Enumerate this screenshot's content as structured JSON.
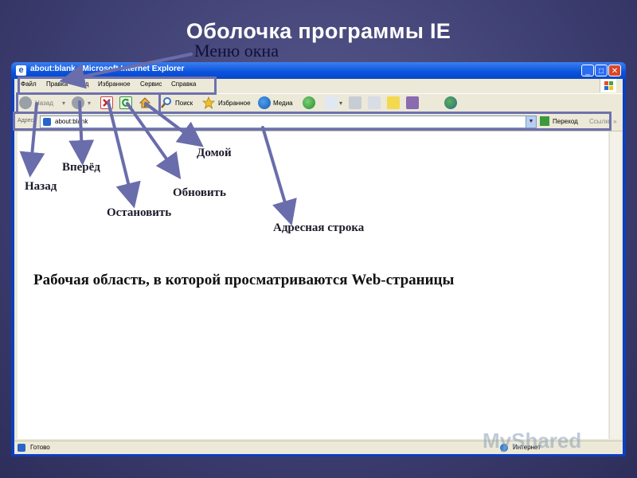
{
  "slide": {
    "title": "Оболочка программы IE",
    "menu_caption": "Меню окна"
  },
  "window": {
    "title": "about:blank - Microsoft Internet Explorer",
    "menu": [
      "Файл",
      "Правка",
      "Вид",
      "Избранное",
      "Сервис",
      "Справка"
    ],
    "toolbar": {
      "back": "Назад",
      "search": "Поиск",
      "favorites": "Избранное",
      "media": "Медиа"
    },
    "address": {
      "label": "Адрес",
      "value": "about:blank",
      "go": "Переход",
      "links": "Ссылки"
    },
    "status": {
      "text": "Готово",
      "zone": "Интернет"
    }
  },
  "annotations": {
    "back": "Назад",
    "forward": "Вперёд",
    "stop": "Остановить",
    "refresh": "Обновить",
    "home": "Домой",
    "address_bar": "Адресная строка",
    "work_area": "Рабочая область, в которой просматриваются Web-страницы"
  },
  "watermark": "MyShared",
  "colors": {
    "slide_background": "#3f4074",
    "title_bar": "#0a52dc",
    "highlight": "#6e71ad"
  }
}
